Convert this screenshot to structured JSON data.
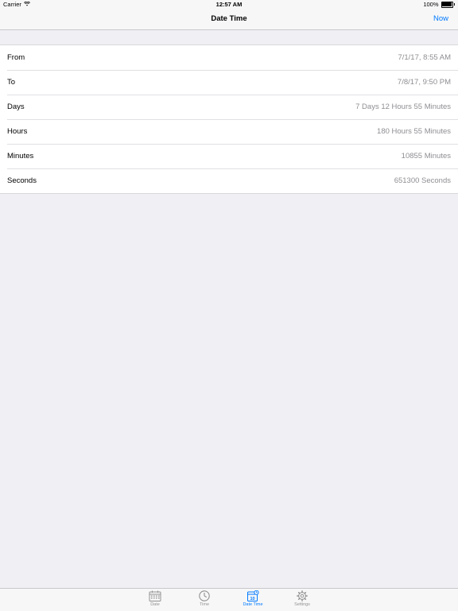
{
  "status_bar": {
    "carrier": "Carrier",
    "time": "12:57 AM",
    "battery": "100%"
  },
  "nav": {
    "title": "Date Time",
    "action_label": "Now"
  },
  "rows": [
    {
      "label": "From",
      "value": "7/1/17, 8:55 AM"
    },
    {
      "label": "To",
      "value": "7/8/17, 9:50 PM"
    },
    {
      "label": "Days",
      "value": "7 Days 12 Hours 55 Minutes"
    },
    {
      "label": "Hours",
      "value": "180 Hours 55 Minutes"
    },
    {
      "label": "Minutes",
      "value": "10855 Minutes"
    },
    {
      "label": "Seconds",
      "value": "651300 Seconds"
    }
  ],
  "tabs": [
    {
      "label": "Date",
      "icon": "calendar-icon",
      "active": false
    },
    {
      "label": "Time",
      "icon": "clock-icon",
      "active": false
    },
    {
      "label": "Date Time",
      "icon": "calendar-clock-icon",
      "active": true
    },
    {
      "label": "Settings",
      "icon": "gear-icon",
      "active": false
    }
  ],
  "colors": {
    "accent": "#007aff",
    "background": "#efeff4",
    "value_text": "#8e8e93"
  }
}
